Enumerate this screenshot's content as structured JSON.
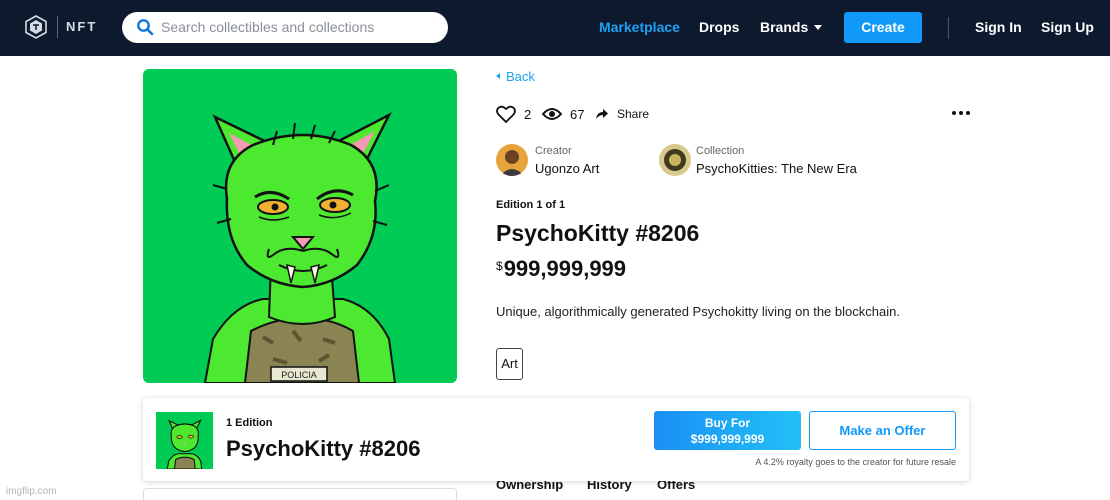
{
  "header": {
    "logo_text": "NFT",
    "search_placeholder": "Search collectibles and collections",
    "nav": {
      "marketplace": "Marketplace",
      "drops": "Drops",
      "brands": "Brands",
      "create": "Create",
      "sign_in": "Sign In",
      "sign_up": "Sign Up"
    }
  },
  "detail": {
    "back": "Back",
    "likes": "2",
    "views": "67",
    "share": "Share",
    "creator_label": "Creator",
    "creator_name": "Ugonzo Art",
    "collection_label": "Collection",
    "collection_name": "PsychoKitties: The New Era",
    "edition": "Edition 1 of 1",
    "title": "PsychoKitty #8206",
    "price_currency": "$",
    "price": "999,999,999",
    "description": "Unique, algorithmically generated Psychokitty living on the blockchain.",
    "tag": "Art"
  },
  "tabs": [
    "Ownership",
    "History",
    "Offers"
  ],
  "buybar": {
    "edition": "1 Edition",
    "title": "PsychoKitty #8206",
    "buy_line1": "Buy For",
    "buy_line2": "$999,999,999",
    "offer": "Make an Offer",
    "royalty": "A 4.2% royalty goes to the creator for future resale"
  },
  "artwork": {
    "vest_text": "POLICIA"
  },
  "watermark": "imgflip.com",
  "colors": {
    "header_bg": "#0d1a2e",
    "accent": "#1199fa",
    "link": "#1da1f2",
    "art_bg": "#00cc55"
  }
}
